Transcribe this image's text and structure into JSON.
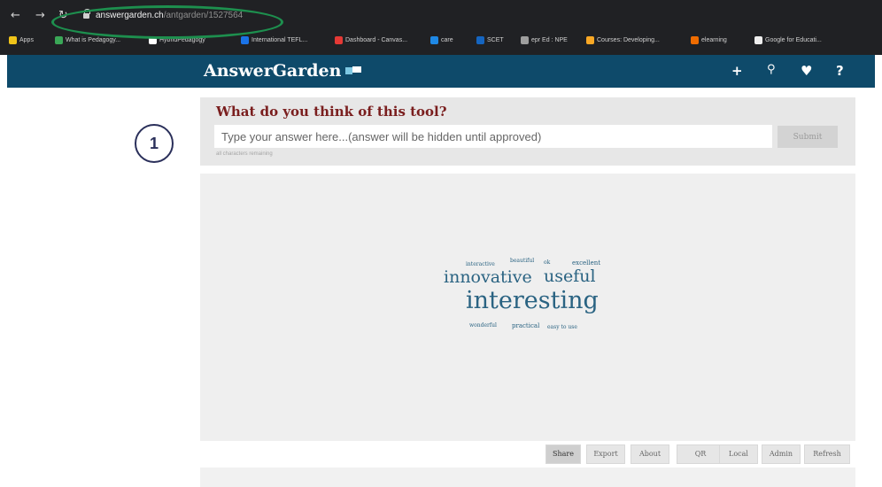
{
  "browser": {
    "url_host": "answergarden.ch",
    "url_path": "/antgarden/1527564",
    "bookmarks": [
      {
        "label": "Apps",
        "color": "#f0c419"
      },
      {
        "label": "What is Pedagogy...",
        "color": "#3aa757"
      },
      {
        "label": "HybridPedagogy",
        "color": "#ffffff"
      },
      {
        "label": "International TEFL...",
        "color": "#1a73e8"
      },
      {
        "label": "Dashboard - Canvas...",
        "color": "#e53935"
      },
      {
        "label": "care",
        "color": "#1e88e5"
      },
      {
        "label": "SCET",
        "color": "#1565c0"
      },
      {
        "label": "epr Ed : NPE",
        "color": "#9e9e9e"
      },
      {
        "label": "Courses: Developing...",
        "color": "#f9a825"
      },
      {
        "label": "elearning",
        "color": "#ef6c00"
      },
      {
        "label": "Google for Educati...",
        "color": "#eeeeee"
      }
    ]
  },
  "app": {
    "title": "AnswerGarden",
    "header_icons": [
      "plus-icon",
      "search-icon",
      "heart-icon",
      "help-icon"
    ],
    "header_icon_glyphs": [
      "+",
      "⚲",
      "♥",
      "?"
    ]
  },
  "question": "What do you think of this tool?",
  "answer": {
    "placeholder": "Type your answer here...(answer will be hidden until approved)",
    "submit_label": "Submit",
    "char_note": "all characters remaining"
  },
  "word_cloud": [
    {
      "text": "interactive",
      "weight": 1
    },
    {
      "text": "beautiful",
      "weight": 1
    },
    {
      "text": "ok",
      "weight": 1
    },
    {
      "text": "excellent",
      "weight": 1
    },
    {
      "text": "innovative",
      "weight": 3
    },
    {
      "text": "useful",
      "weight": 3
    },
    {
      "text": "interesting",
      "weight": 5
    },
    {
      "text": "wonderful",
      "weight": 1
    },
    {
      "text": "practical",
      "weight": 1
    },
    {
      "text": "easy to use",
      "weight": 1
    }
  ],
  "toolbar": {
    "buttons": [
      "Share",
      "Export",
      "About",
      "QR",
      "Local",
      "Admin",
      "Refresh"
    ],
    "active": "Share"
  },
  "annotation": {
    "step_number": "1"
  },
  "colors": {
    "header": "#0e4a6a",
    "question": "#7a1e1e",
    "cloud_words": "#2a6382",
    "highlight": "#1d8f4e"
  }
}
